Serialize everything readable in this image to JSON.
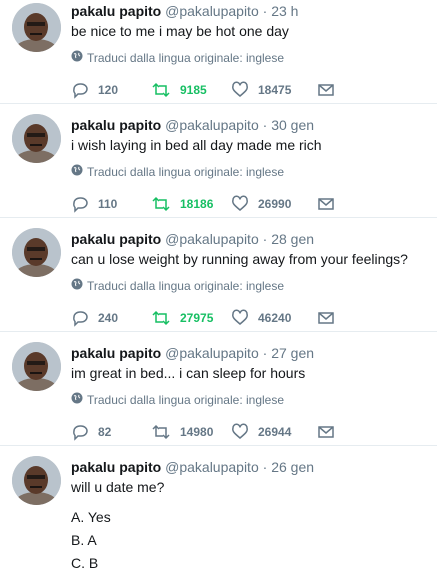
{
  "retweet_color": "#17bf63",
  "muted_color": "#657786",
  "icons": {
    "reply": "reply-icon",
    "retweet": "retweet-icon",
    "like": "like-icon",
    "dm": "envelope-icon",
    "globe": "globe-icon"
  },
  "tweets": [
    {
      "name": "pakalu papito",
      "handle": "@pakalupapito",
      "sep": "·",
      "time": "23 h",
      "text": "be nice to me i may be hot one day",
      "translate": "Traduci dalla lingua originale: inglese",
      "replies": "120",
      "retweets": "9185",
      "likes": "18475"
    },
    {
      "name": "pakalu papito",
      "handle": "@pakalupapito",
      "sep": "·",
      "time": "30 gen",
      "text": "i wish laying in bed all day made me rich",
      "translate": "Traduci dalla lingua originale: inglese",
      "replies": "110",
      "retweets": "18186",
      "likes": "26990"
    },
    {
      "name": "pakalu papito",
      "handle": "@pakalupapito",
      "sep": "·",
      "time": "28 gen",
      "text": "can u lose weight by running away from your feelings?",
      "translate": "Traduci dalla lingua originale: inglese",
      "replies": "240",
      "retweets": "27975",
      "likes": "46240"
    },
    {
      "name": "pakalu papito",
      "handle": "@pakalupapito",
      "sep": "·",
      "time": "27 gen",
      "text": "im great in bed... i can sleep for hours",
      "translate": "Traduci dalla lingua originale: inglese",
      "replies": "82",
      "retweets": "14980",
      "likes": "26944"
    },
    {
      "name": "pakalu papito",
      "handle": "@pakalupapito",
      "sep": "·",
      "time": "26 gen",
      "text": "will u date me?",
      "poll": [
        "A. Yes",
        "B. A",
        "C. B"
      ]
    }
  ]
}
